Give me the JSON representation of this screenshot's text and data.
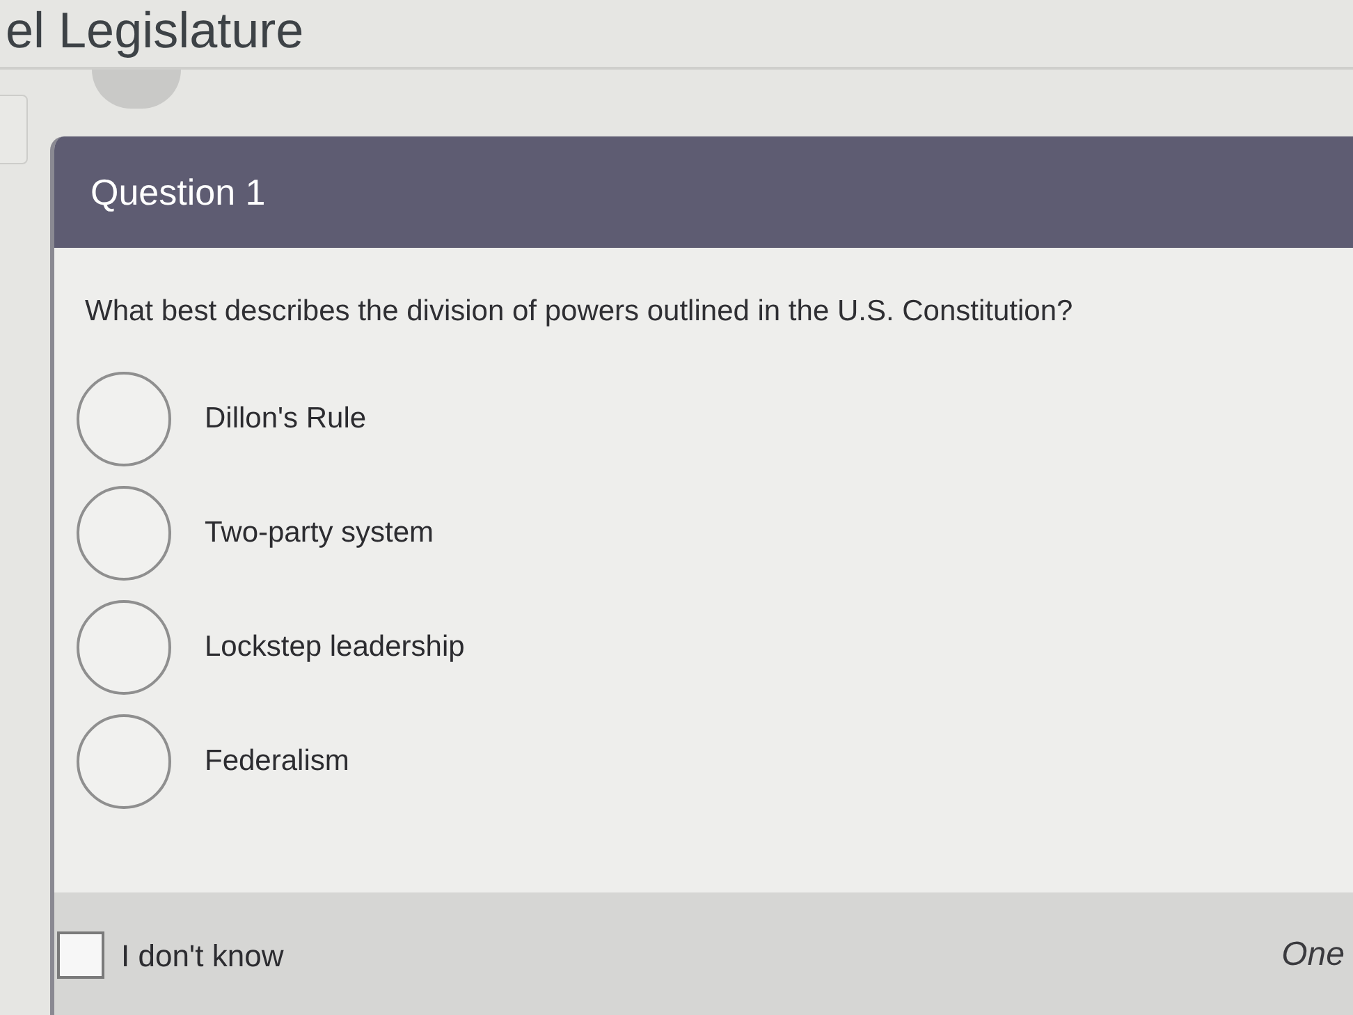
{
  "page_title": "el Legislature",
  "question": {
    "title": "Question 1",
    "prompt": "What best describes the division of powers outlined in the U.S. Constitution?",
    "options": [
      {
        "label": "Dillon's Rule",
        "selected": false
      },
      {
        "label": "Two-party system",
        "selected": false
      },
      {
        "label": "Lockstep leadership",
        "selected": false
      },
      {
        "label": "Federalism",
        "selected": false
      }
    ],
    "dont_know": {
      "label": "I don't know",
      "checked": false
    },
    "footer_note": "One"
  }
}
